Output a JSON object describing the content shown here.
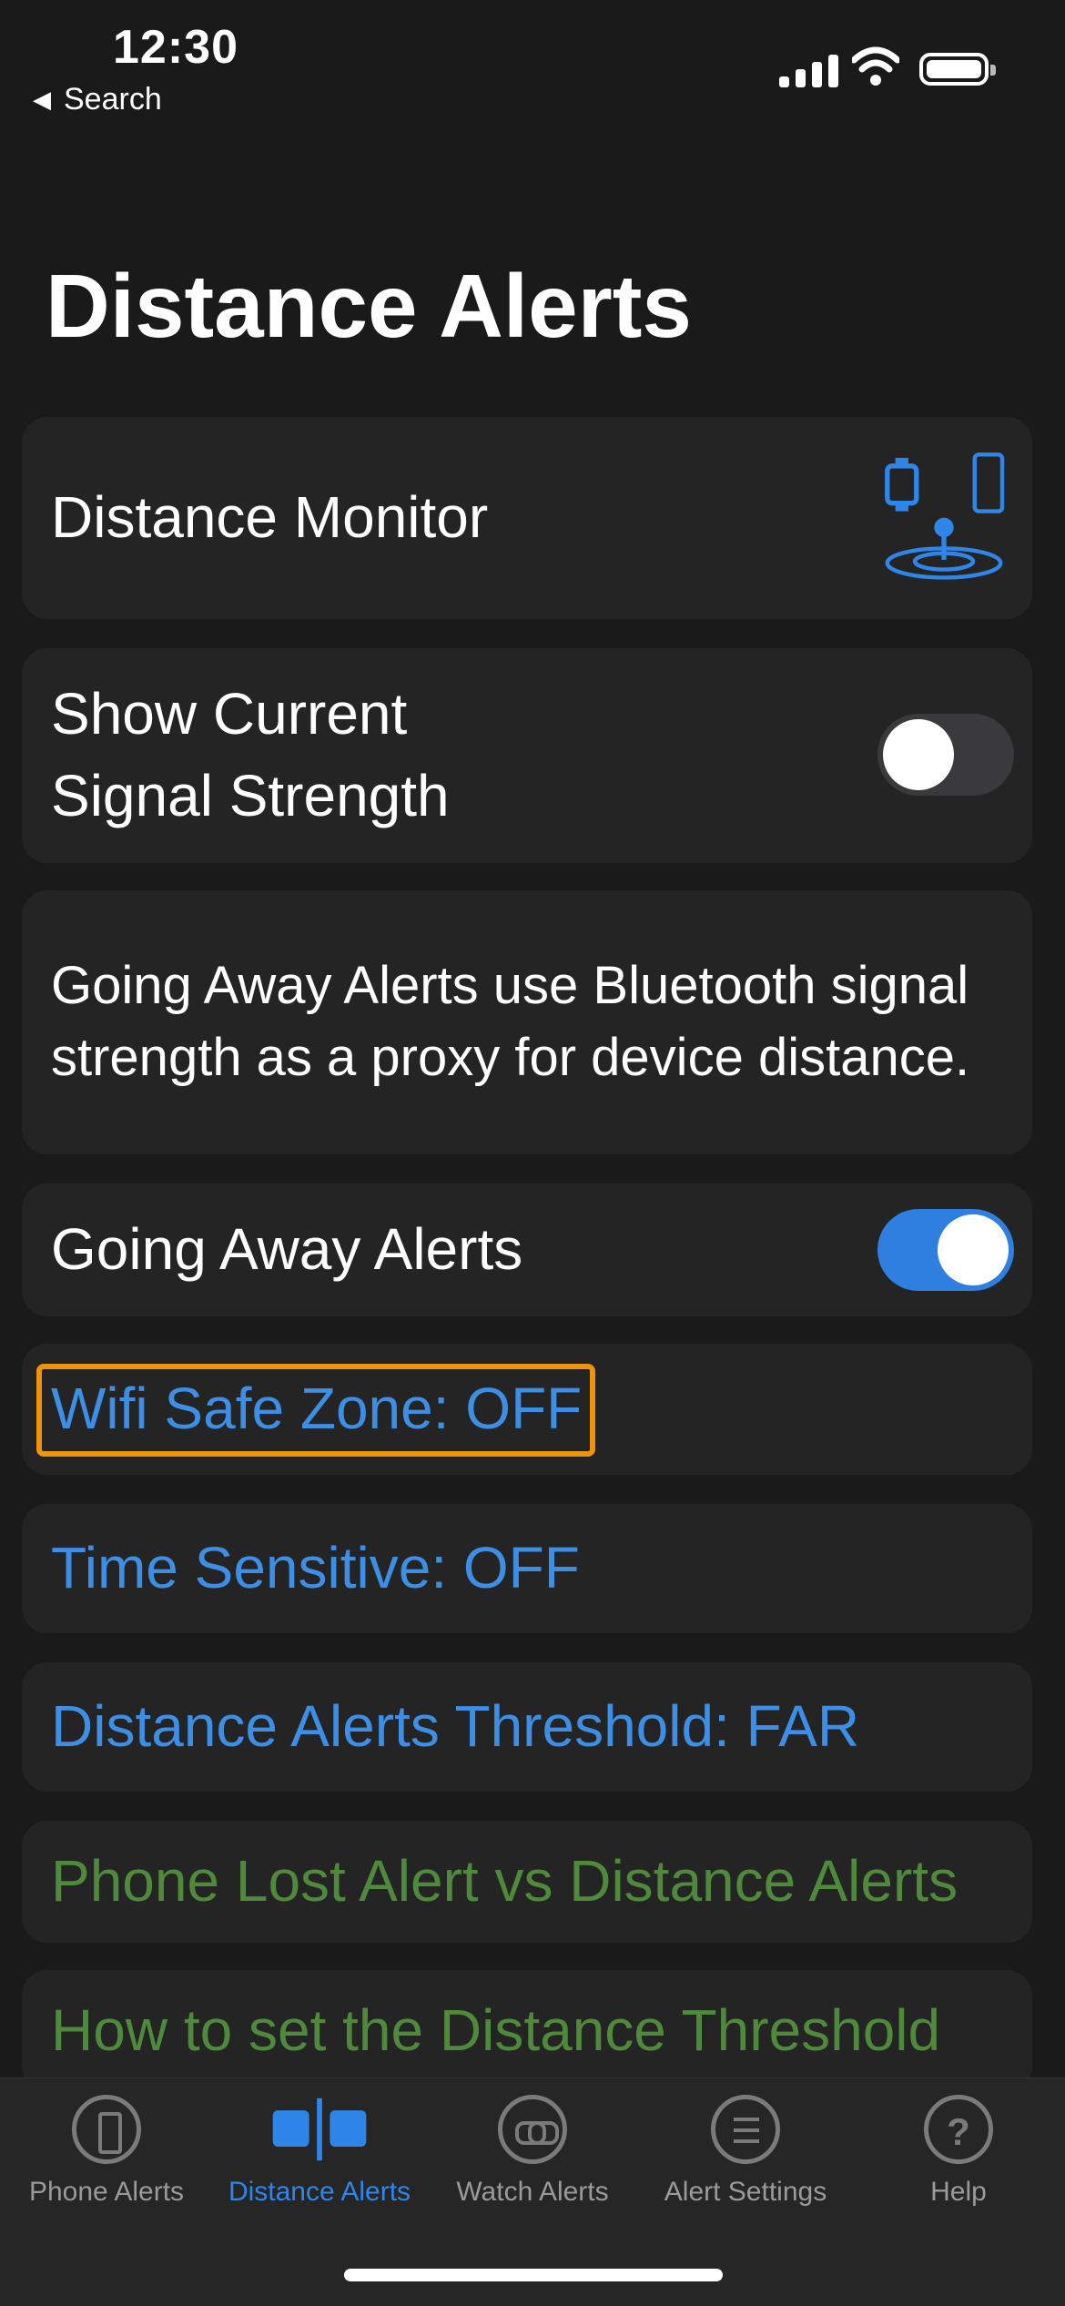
{
  "status_bar": {
    "time": "12:30",
    "back_label": "Search"
  },
  "page_title": "Distance Alerts",
  "cards": {
    "distance_monitor": "Distance Monitor",
    "show_signal_line1": "Show Current",
    "show_signal_line2": "Signal Strength",
    "show_signal_toggle": "off",
    "info_text": "Going Away Alerts use Bluetooth signal strength as a proxy for device distance.",
    "going_away": "Going Away Alerts",
    "going_away_toggle": "on",
    "wifi_safe_zone": "Wifi Safe Zone: OFF",
    "time_sensitive": "Time Sensitive: OFF",
    "threshold": "Distance Alerts Threshold: FAR",
    "phone_lost_vs": "Phone Lost Alert vs Distance Alerts",
    "how_to_set": "How to set the Distance Threshold"
  },
  "tabs": [
    {
      "label": "Phone Alerts",
      "icon": "phone-icon"
    },
    {
      "label": "Distance Alerts",
      "icon": "distance-icon",
      "active": true
    },
    {
      "label": "Watch Alerts",
      "icon": "link-icon"
    },
    {
      "label": "Alert Settings",
      "icon": "list-icon"
    },
    {
      "label": "Help",
      "icon": "help-icon"
    }
  ],
  "colors": {
    "accent_blue": "#3d8fe6",
    "link_green": "#4f8a3c",
    "highlight_orange": "#f0930c"
  }
}
